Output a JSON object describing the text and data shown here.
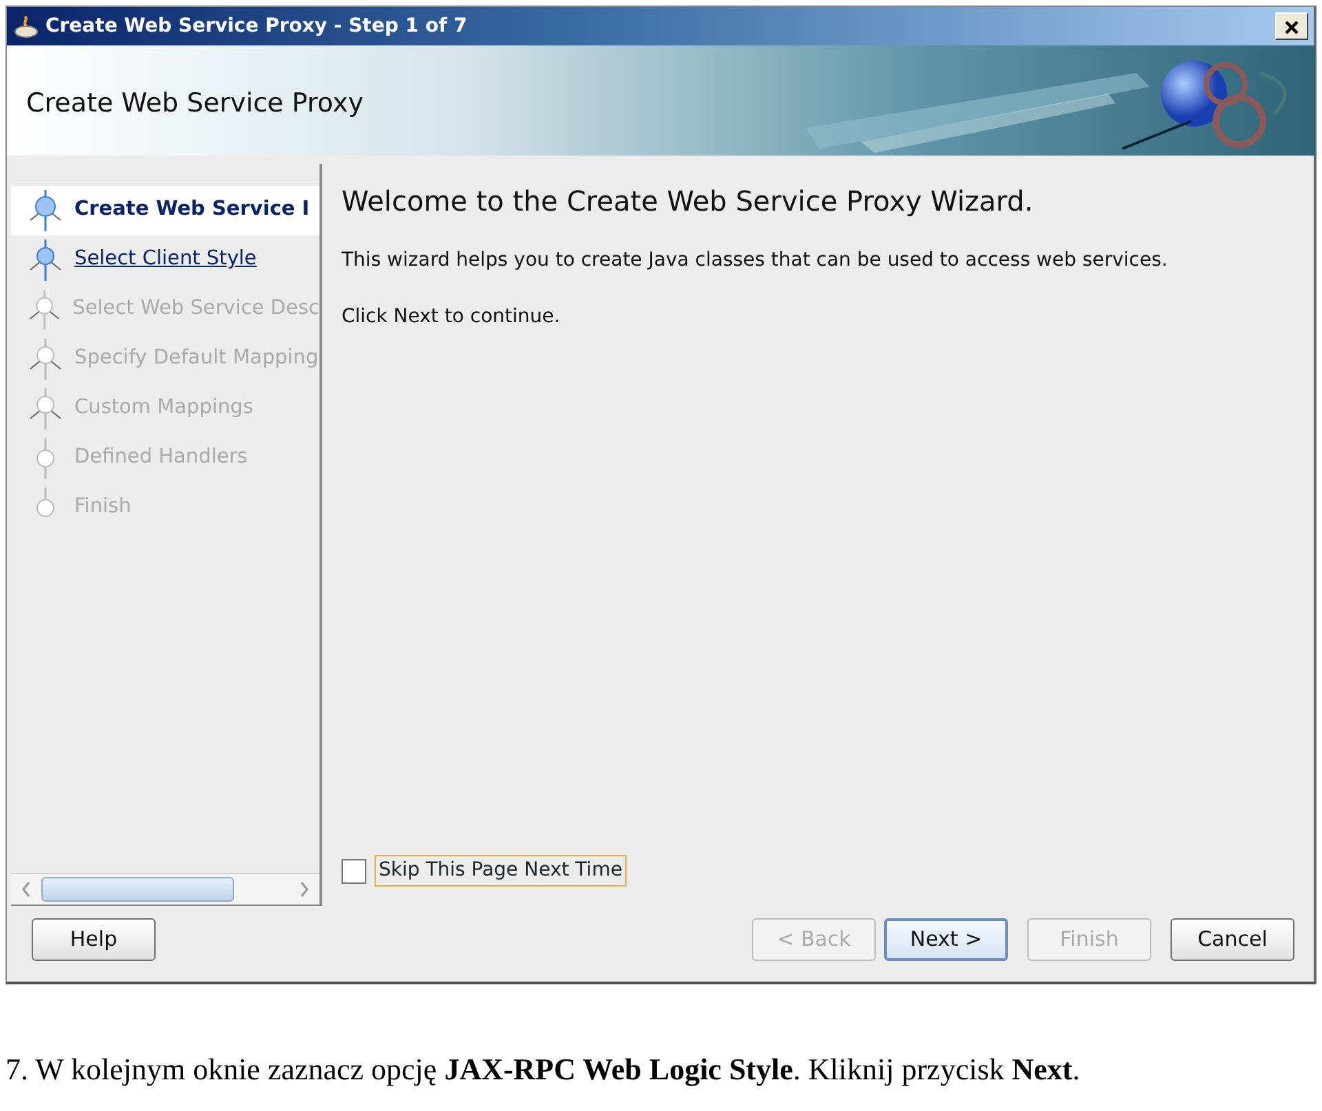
{
  "window": {
    "title": "Create Web Service Proxy - Step 1 of 7"
  },
  "header": {
    "title": "Create Web Service Proxy"
  },
  "steps": [
    {
      "label": "Create Web Service I",
      "selected": true,
      "enabled": true,
      "kind": "branch"
    },
    {
      "label": "Select Client Style",
      "selected": false,
      "enabled": true,
      "kind": "branch"
    },
    {
      "label": "Select Web Service Desc",
      "selected": false,
      "enabled": false,
      "kind": "branch"
    },
    {
      "label": "Specify Default Mapping",
      "selected": false,
      "enabled": false,
      "kind": "branch"
    },
    {
      "label": "Custom Mappings",
      "selected": false,
      "enabled": false,
      "kind": "branch"
    },
    {
      "label": "Defined Handlers",
      "selected": false,
      "enabled": false,
      "kind": "leaf"
    },
    {
      "label": "Finish",
      "selected": false,
      "enabled": false,
      "kind": "leaf"
    }
  ],
  "content": {
    "heading": "Welcome to the Create Web Service Proxy Wizard.",
    "paragraphs": [
      "This wizard helps you to create Java classes that can be used to access web services.",
      "Click Next to continue."
    ]
  },
  "skip_checkbox": {
    "label": "Skip This Page Next Time",
    "checked": false
  },
  "buttons": [
    {
      "label": "Help",
      "disabled": false,
      "default": false
    },
    {
      "label": "< Back",
      "disabled": true,
      "default": false
    },
    {
      "label": "Next >",
      "disabled": false,
      "default": true
    },
    {
      "label": "Finish",
      "disabled": true,
      "default": false
    },
    {
      "label": "Cancel",
      "disabled": false,
      "default": false
    }
  ],
  "caption": "7. W kolejnym oknie zaznacz opcję **JAX-RPC Web Logic Style**. Kliknij przycisk **Next**."
}
